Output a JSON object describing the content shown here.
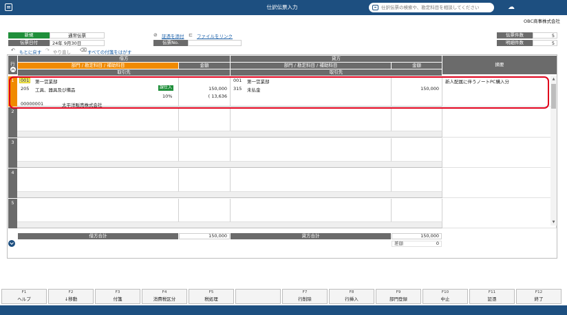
{
  "titlebar": {
    "title": "仕訳伝票入力",
    "search_placeholder": "仕訳伝票の検索や、勘定科目を相談してください"
  },
  "company": "OBC商事株式会社",
  "voucher": {
    "mode_label": "新規",
    "type_value": "通常伝票",
    "date_label": "伝票日付",
    "date_value": "24年  9月30日",
    "number_label": "伝票No.",
    "number_value": ""
  },
  "links": {
    "attach_evidence": "証憑を添付",
    "link_file": "ファイルをリンク",
    "undo": "もとに戻す",
    "redo": "やり直し",
    "detach_all": "すべての付箋をはがす"
  },
  "counts": {
    "voucher_count_label": "伝票件数",
    "voucher_count": "5",
    "detail_count_label": "明細件数",
    "detail_count": "5"
  },
  "grid": {
    "row_header": "行",
    "debit_header": "借方",
    "credit_header": "貸方",
    "debit_account_header": "部門 / 勘定科目 / 補助科目",
    "debit_amount_header": "金額",
    "credit_account_header": "部門 / 勘定科目 / 補助科目",
    "credit_amount_header": "金額",
    "summary_header": "摘要",
    "partner_header_debit": "取引先",
    "partner_header_credit": "取引先",
    "rows": [
      {
        "num": "1",
        "debit_dept_code": "001",
        "debit_dept_name": "第一営業部",
        "debit_account_code": "205",
        "debit_account_name": "工具、器具及び備品",
        "debit_tax_badge": "課仕入",
        "debit_tax_rate": "10%",
        "debit_amount": "150,000",
        "debit_tax_amount": "( 13,636",
        "credit_dept_code": "001",
        "credit_dept_name": "第一営業部",
        "credit_account_code": "315",
        "credit_account_name": "未払金",
        "credit_amount": "150,000",
        "summary": "新人配属に伴うノートPC購入分",
        "partner_code": "00000001",
        "partner_name": "太平洋販売株式会社"
      },
      {
        "num": "2"
      },
      {
        "num": "3"
      },
      {
        "num": "4"
      },
      {
        "num": "5"
      }
    ]
  },
  "totals": {
    "debit_total_label": "借方合計",
    "debit_total": "150,000",
    "credit_total_label": "貸方合計",
    "credit_total": "150,000",
    "diff_label": "差額",
    "diff_value": "0"
  },
  "fkeys": [
    {
      "key": "F1",
      "label": "ヘルプ"
    },
    {
      "key": "F2",
      "label": "↓移動"
    },
    {
      "key": "F3",
      "label": "付箋"
    },
    {
      "key": "F4",
      "label": "消費税区分"
    },
    {
      "key": "F5",
      "label": "税処理"
    },
    {
      "key": "",
      "label": ""
    },
    {
      "key": "F7",
      "label": "行削除"
    },
    {
      "key": "F8",
      "label": "行挿入"
    },
    {
      "key": "F9",
      "label": "部門登録"
    },
    {
      "key": "F10",
      "label": "中止"
    },
    {
      "key": "F11",
      "label": "証憑"
    },
    {
      "key": "F12",
      "label": "終了"
    }
  ]
}
